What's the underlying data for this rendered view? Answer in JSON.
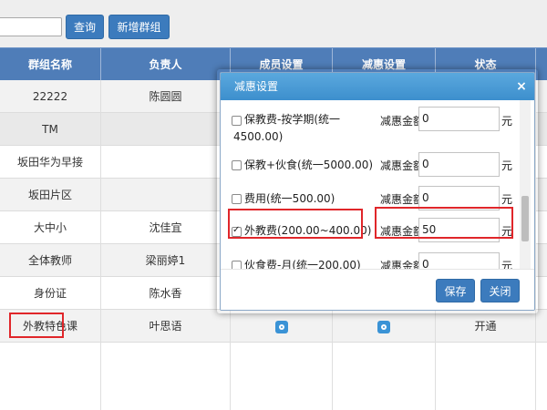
{
  "toolbar": {
    "search_value": "",
    "query_label": "查询",
    "new_group_label": "新增群组"
  },
  "table": {
    "headers": [
      "群组名称",
      "负责人",
      "成员设置",
      "减惠设置",
      "状态"
    ],
    "rows": [
      {
        "name": "22222",
        "owner": "陈圆圆",
        "status": ""
      },
      {
        "name": "TM",
        "owner": "",
        "status": ""
      },
      {
        "name": "坂田华为早接",
        "owner": "",
        "status": ""
      },
      {
        "name": "坂田片区",
        "owner": "",
        "status": ""
      },
      {
        "name": "大中小",
        "owner": "沈佳宜",
        "status": ""
      },
      {
        "name": "全体教师",
        "owner": "梁丽婷1",
        "status": ""
      },
      {
        "name": "身份证",
        "owner": "陈水香",
        "status": ""
      },
      {
        "name": "外教特色课",
        "owner": "叶思语",
        "status": "开通"
      }
    ]
  },
  "modal": {
    "title": "减惠设置",
    "close_glyph": "×",
    "items": [
      {
        "label_line1": "保教费-按学期(统一",
        "label_line2": "4500.00)",
        "checked": false,
        "discount_label": "减惠金额",
        "value": "0",
        "unit": "元"
      },
      {
        "label_line1": "保教+伙食(统一5000.00)",
        "label_line2": "",
        "checked": false,
        "discount_label": "减惠金额",
        "value": "0",
        "unit": "元"
      },
      {
        "label_line1": "费用(统一500.00)",
        "label_line2": "",
        "checked": false,
        "discount_label": "减惠金额",
        "value": "0",
        "unit": "元"
      },
      {
        "label_line1": "外教费(200.00~400.00)",
        "label_line2": "",
        "checked": true,
        "discount_label": "减惠金额",
        "value": "50",
        "unit": "元"
      },
      {
        "label_line1": "伙食费-月(统一200.00)",
        "label_line2": "",
        "checked": false,
        "discount_label": "减惠金额",
        "value": "0",
        "unit": "元"
      }
    ],
    "save_label": "保存",
    "close_label": "关闭"
  },
  "colors": {
    "accent": "#3c7bbd",
    "table_header": "#4f7db8",
    "highlight_border": "#e0262a"
  }
}
